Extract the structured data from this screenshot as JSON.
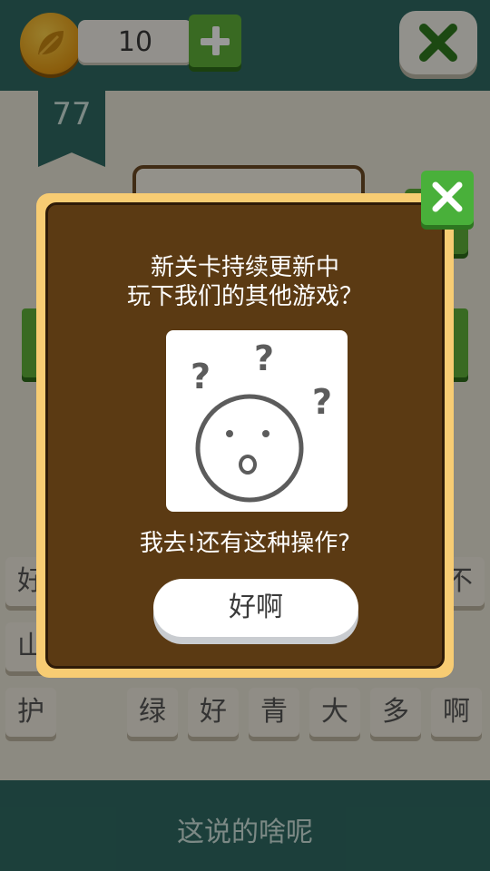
{
  "header": {
    "coin_count": "10"
  },
  "level": {
    "number": "77"
  },
  "tiles": {
    "row1": [
      "好",
      "不"
    ],
    "row2": [
      "山"
    ],
    "row3": [
      "护",
      "绿",
      "好",
      "青",
      "大",
      "多",
      "啊"
    ]
  },
  "bottom": {
    "hint_text": "这说的啥呢"
  },
  "dialog": {
    "line1": "新关卡持续更新中",
    "line2": "玩下我们的其他游戏？",
    "caption": "我去!还有这种操作?",
    "ok_label": "好啊"
  },
  "colors": {
    "dialog_border": "#f7cc73",
    "dialog_bg": "#5b3a13",
    "accent_green": "#5fb13a",
    "topbar": "#2f6a63"
  },
  "icons": {
    "coin": "leaf-coin-icon",
    "add": "plus-icon",
    "close": "close-x-icon",
    "illustration": "confused-face-icon"
  }
}
